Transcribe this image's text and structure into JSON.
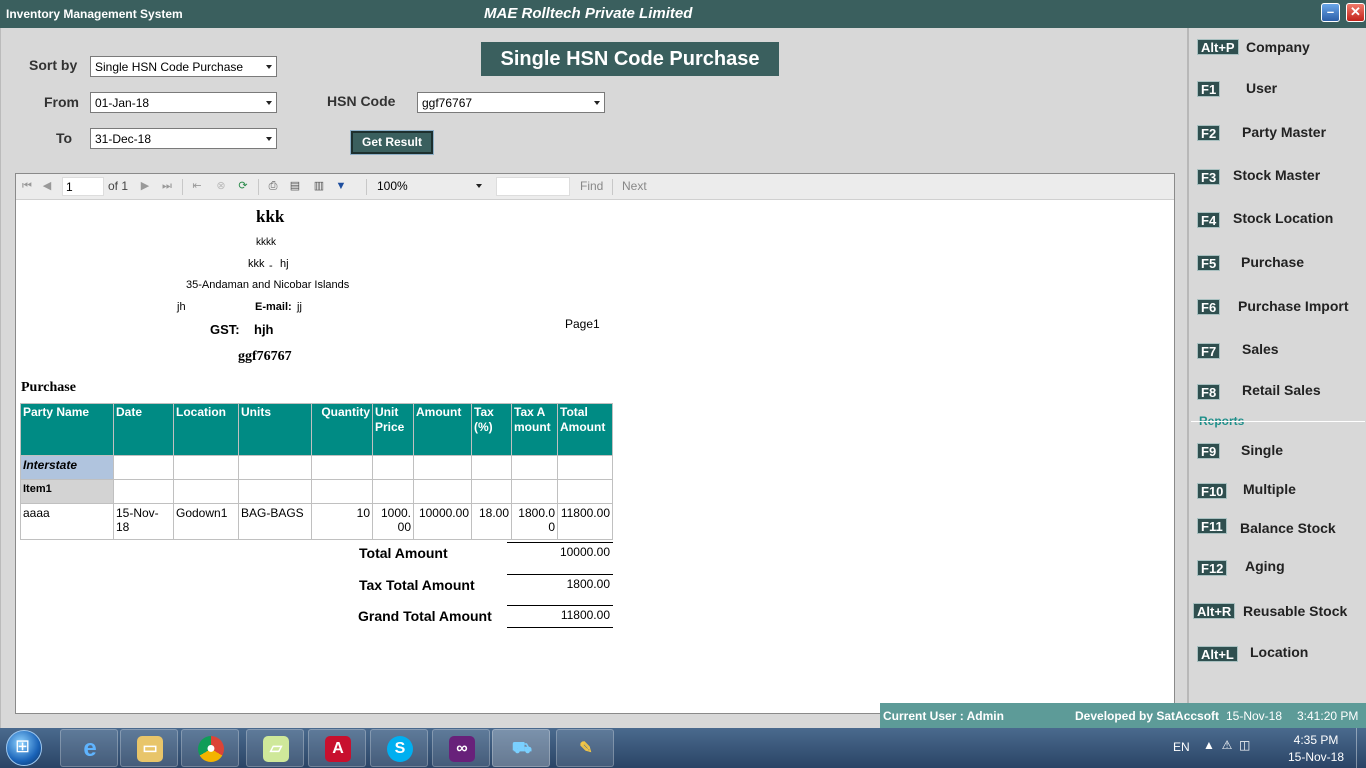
{
  "window": {
    "app_title": "Inventory Management System",
    "company_title": "MAE Rolltech Private Limited",
    "minimize": "–",
    "close": "✕"
  },
  "filters": {
    "sort_by_label": "Sort by",
    "sort_by_value": "Single HSN Code Purchase",
    "from_label": "From",
    "from_value": "01-Jan-18",
    "to_label": "To",
    "to_value": "31-Dec-18",
    "hsn_label": "HSN Code",
    "hsn_value": "ggf76767",
    "get_result": "Get Result"
  },
  "report_title": "Single HSN Code Purchase",
  "viewer": {
    "page": "1",
    "of_text": "of 1",
    "zoom": "100%",
    "find": "Find",
    "next": "Next"
  },
  "report": {
    "company": "kkk",
    "line1": "kkkk",
    "line2a": "kkk",
    "line2b": "-",
    "line2c": "hj",
    "line3": "35-Andaman and Nicobar Islands",
    "contact": "jh",
    "email_label": "E-mail:",
    "email_value": "jj",
    "gst_label": "GST:",
    "gst_value": "hjh",
    "page_label": "Page1",
    "hsn": "ggf76767",
    "section": "Purchase",
    "columns": [
      "Party Name",
      "Date",
      "Location",
      "Units",
      "Quantity",
      "Unit Price",
      "Amount",
      "Tax (%)",
      "Tax Amount",
      "Total Amount"
    ],
    "group1": "Interstate",
    "group2": "Item1",
    "row": [
      "aaaa",
      "15-Nov-18",
      "Godown1",
      "BAG-BAGS",
      "10",
      "1000.00",
      "10000.00",
      "18.00",
      "1800.00",
      "11800.00"
    ],
    "total_amount_label": "Total Amount",
    "total_amount": "10000.00",
    "tax_total_label": "Tax Total Amount",
    "tax_total": "1800.00",
    "grand_total_label": "Grand Total Amount",
    "grand_total": "11800.00"
  },
  "menu": {
    "items": [
      {
        "key": "Alt+P",
        "label": "Company"
      },
      {
        "key": "F1",
        "label": "User"
      },
      {
        "key": "F2",
        "label": "Party Master"
      },
      {
        "key": "F3",
        "label": "Stock Master"
      },
      {
        "key": "F4",
        "label": "Stock Location"
      },
      {
        "key": "F5",
        "label": "Purchase"
      },
      {
        "key": "F6",
        "label": "Purchase Import"
      },
      {
        "key": "F7",
        "label": "Sales"
      },
      {
        "key": "F8",
        "label": "Retail Sales"
      }
    ],
    "reports_heading": "Reports",
    "reports": [
      {
        "key": "F9",
        "label": "Single"
      },
      {
        "key": "F10",
        "label": "Multiple"
      },
      {
        "key": "F11",
        "label": "Balance Stock"
      },
      {
        "key": "F12",
        "label": "Aging"
      },
      {
        "key": "Alt+R",
        "label": "Reusable Stock"
      },
      {
        "key": "Alt+L",
        "label": "Location"
      }
    ]
  },
  "status": {
    "user": "Current User : Admin",
    "developer": "Developed by SatAccsoft",
    "date": "15-Nov-18",
    "time": "3:41:20 PM"
  },
  "taskbar": {
    "lang": "EN",
    "time": "4:35 PM",
    "date": "15-Nov-18"
  }
}
